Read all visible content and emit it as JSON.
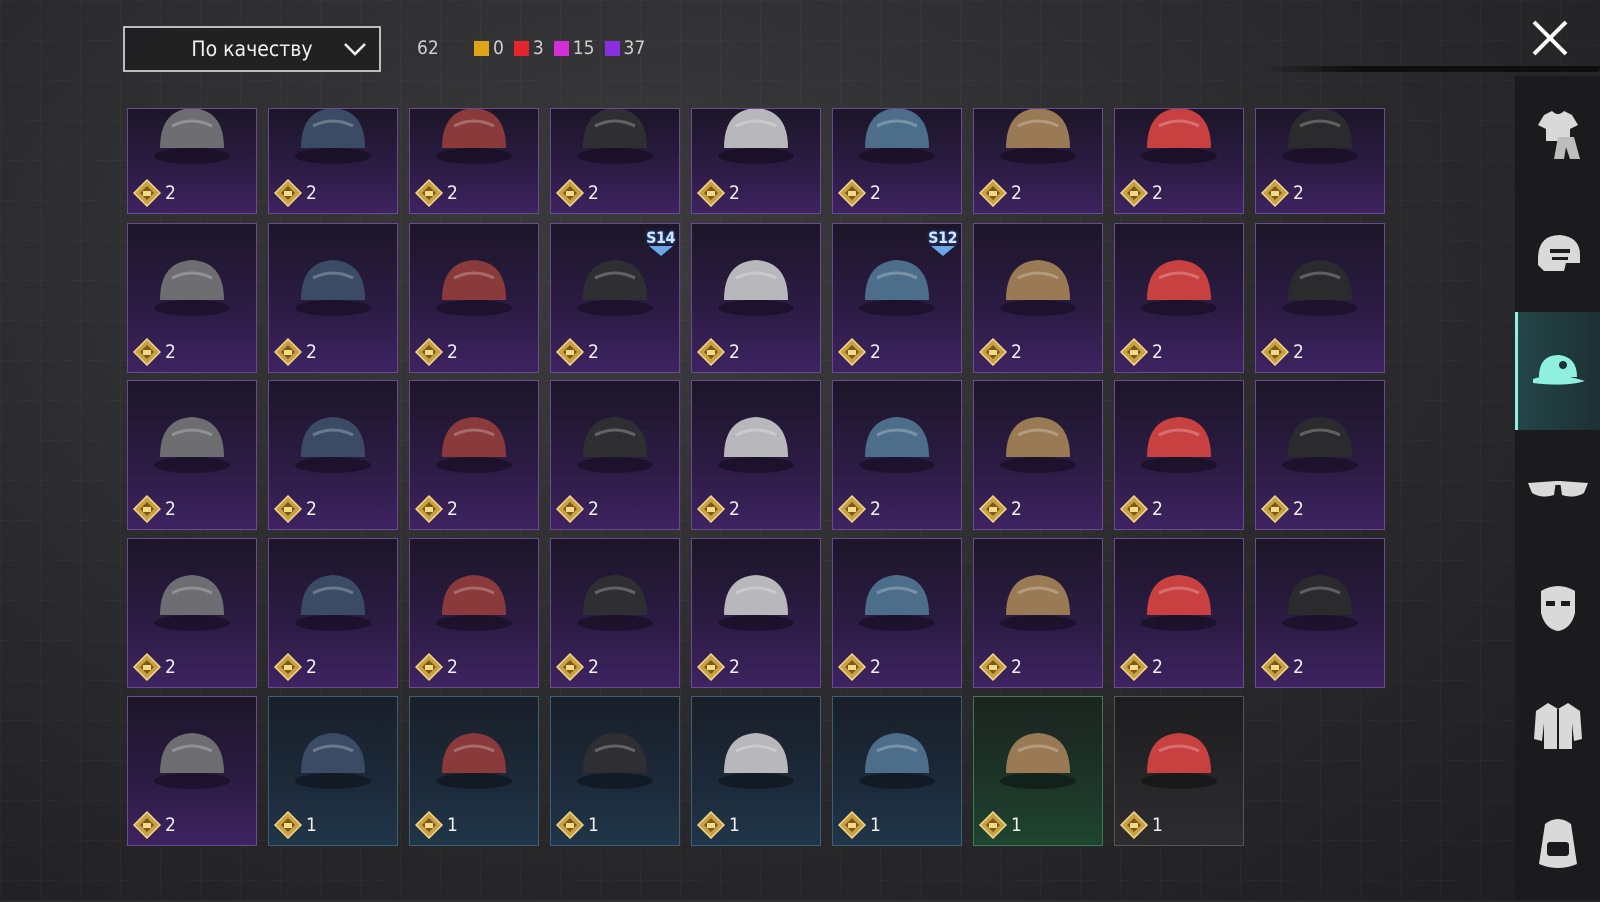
{
  "header": {
    "sort_label": "По качеству",
    "total_count": "62",
    "counts": [
      {
        "value": "0",
        "color": "#e2a417"
      },
      {
        "value": "3",
        "color": "#e3262b"
      },
      {
        "value": "15",
        "color": "#d42ed6"
      },
      {
        "value": "37",
        "color": "#8a2fe0"
      }
    ]
  },
  "sidebar": {
    "tabs": [
      {
        "name": "outfit-icon",
        "active": false
      },
      {
        "name": "helmet-icon",
        "active": false
      },
      {
        "name": "cap-icon",
        "active": true
      },
      {
        "name": "glasses-icon",
        "active": false
      },
      {
        "name": "mask-icon",
        "active": false
      },
      {
        "name": "jacket-icon",
        "active": false
      },
      {
        "name": "backpack-icon",
        "active": false
      }
    ]
  },
  "items": [
    {
      "qty": "2",
      "rarity": "purple",
      "icon": "slime-mask-hair-icon"
    },
    {
      "qty": "2",
      "rarity": "purple",
      "icon": "gasmask-helmet-icon"
    },
    {
      "qty": "2",
      "rarity": "purple",
      "icon": "orange-mech-helmet-icon"
    },
    {
      "qty": "2",
      "rarity": "purple",
      "icon": "navy-beanie-icon"
    },
    {
      "qty": "2",
      "rarity": "purple",
      "icon": "mesh-cap-icon"
    },
    {
      "qty": "2",
      "rarity": "purple",
      "icon": "striped-beanie-icon"
    },
    {
      "qty": "2",
      "rarity": "purple",
      "icon": "silver-wig-icon"
    },
    {
      "qty": "2",
      "rarity": "purple",
      "icon": "headset-cap-icon"
    },
    {
      "qty": "2",
      "rarity": "purple",
      "icon": "chef-gasmask-icon"
    },
    {
      "qty": "2",
      "rarity": "purple",
      "icon": "batting-helmet-icon"
    },
    {
      "qty": "2",
      "rarity": "purple",
      "icon": "tribal-mask-hair-icon"
    },
    {
      "qty": "2",
      "rarity": "purple",
      "icon": "goggle-helmet-icon"
    },
    {
      "qty": "2",
      "rarity": "purple",
      "icon": "chainmail-hood-icon",
      "badge": "S14"
    },
    {
      "qty": "2",
      "rarity": "purple",
      "icon": "white-hood-icon"
    },
    {
      "qty": "2",
      "rarity": "purple",
      "icon": "space-helmet-icon",
      "badge": "S12"
    },
    {
      "qty": "2",
      "rarity": "purple",
      "icon": "bobble-beanie-icon"
    },
    {
      "qty": "2",
      "rarity": "purple",
      "icon": "patterned-beanie-icon"
    },
    {
      "qty": "2",
      "rarity": "purple",
      "icon": "soldier-helmet-icon"
    },
    {
      "qty": "2",
      "rarity": "purple",
      "icon": "black-cap-icon"
    },
    {
      "qty": "2",
      "rarity": "purple",
      "icon": "wrestler-mask-icon"
    },
    {
      "qty": "2",
      "rarity": "purple",
      "icon": "shark-hat-icon"
    },
    {
      "qty": "2",
      "rarity": "purple",
      "icon": "red-beret-icon"
    },
    {
      "qty": "2",
      "rarity": "purple",
      "icon": "bowler-hat-icon"
    },
    {
      "qty": "2",
      "rarity": "purple",
      "icon": "flower-crown-icon"
    },
    {
      "qty": "2",
      "rarity": "purple",
      "icon": "red-bucket-hat-icon"
    },
    {
      "qty": "2",
      "rarity": "purple",
      "icon": "maid-headband-icon"
    },
    {
      "qty": "2",
      "rarity": "purple",
      "icon": "pudding-hat-icon"
    },
    {
      "qty": "2",
      "rarity": "purple",
      "icon": "burger-hat-icon"
    },
    {
      "qty": "2",
      "rarity": "purple",
      "icon": "head-mirror-icon"
    },
    {
      "qty": "2",
      "rarity": "purple",
      "icon": "headband-icon"
    },
    {
      "qty": "2",
      "rarity": "purple",
      "icon": "blue-fez-icon"
    },
    {
      "qty": "2",
      "rarity": "purple",
      "icon": "pink-cap-icon"
    },
    {
      "qty": "2",
      "rarity": "purple",
      "icon": "gold-logo-cap-icon"
    },
    {
      "qty": "2",
      "rarity": "purple",
      "icon": "fedora-icon"
    },
    {
      "qty": "2",
      "rarity": "purple",
      "icon": "bandana-icon"
    },
    {
      "qty": "2",
      "rarity": "purple",
      "icon": "dark-bucket-hat-icon"
    },
    {
      "qty": "2",
      "rarity": "purple",
      "icon": "aviator-cap-icon"
    },
    {
      "qty": "1",
      "rarity": "blue",
      "icon": "blue-beret-icon"
    },
    {
      "qty": "1",
      "rarity": "blue",
      "icon": "gray-beret-icon"
    },
    {
      "qty": "1",
      "rarity": "blue",
      "icon": "trucker-cap-icon"
    },
    {
      "qty": "1",
      "rarity": "blue",
      "icon": "baseball-cap-icon"
    },
    {
      "qty": "1",
      "rarity": "blue",
      "icon": "camo-boonie-icon"
    },
    {
      "qty": "1",
      "rarity": "green",
      "icon": "patrol-cap-icon"
    },
    {
      "qty": "1",
      "rarity": "gray",
      "icon": "black-beanie-icon"
    }
  ]
}
